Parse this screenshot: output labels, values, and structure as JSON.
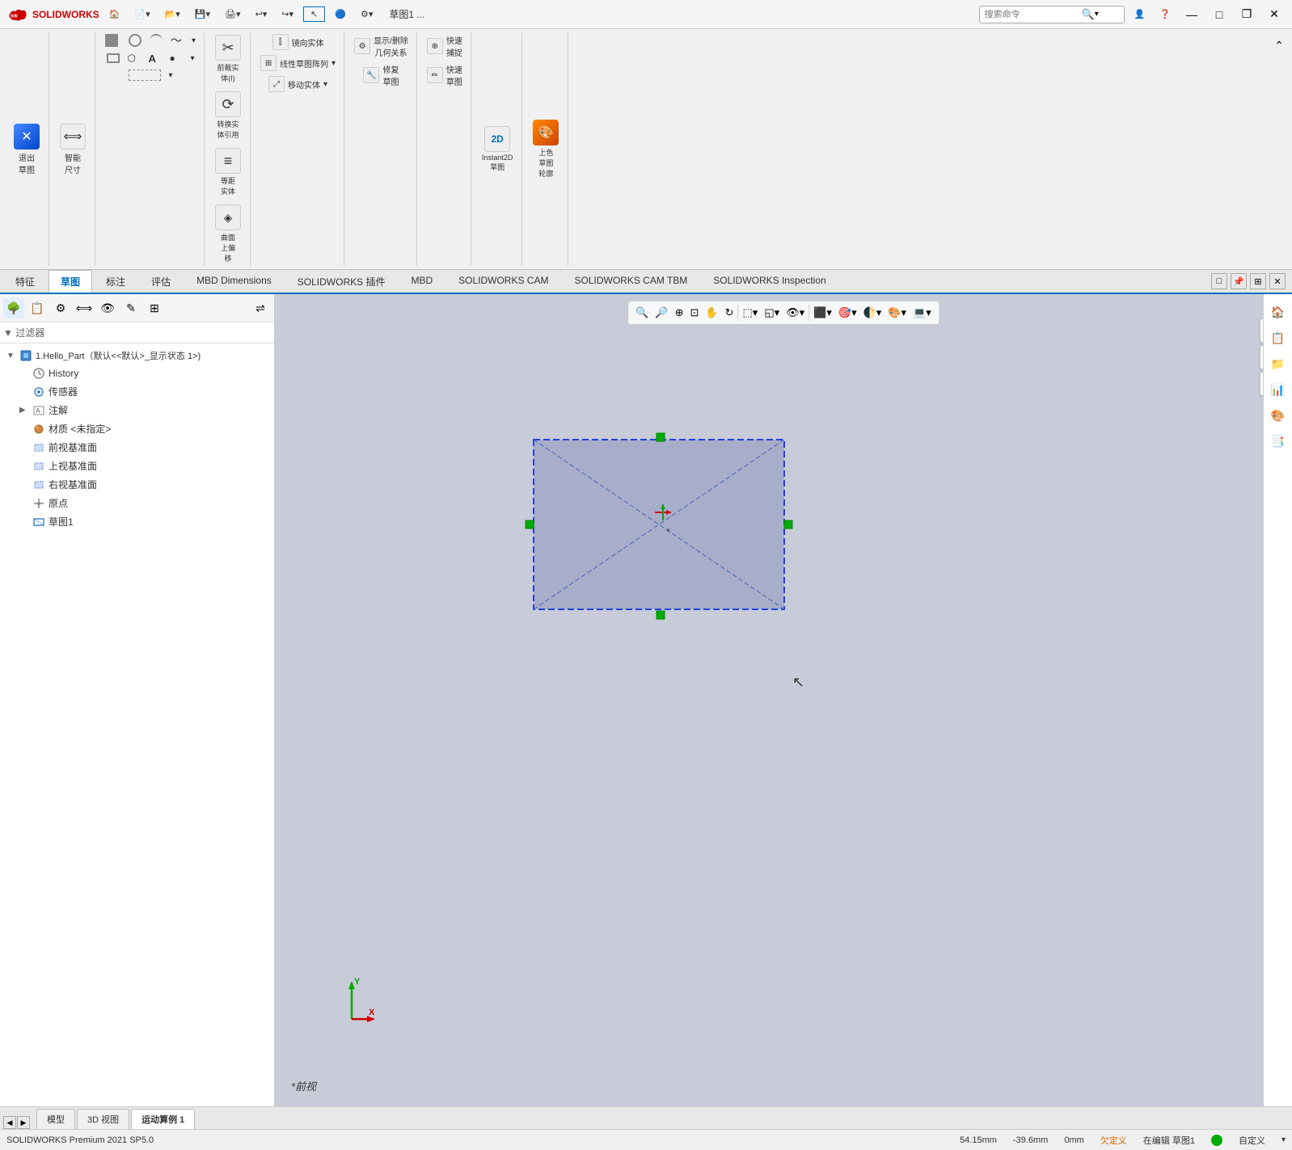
{
  "app": {
    "name": "SOLIDWORKS",
    "logo_text": "SOLIDWORKS",
    "title": "草图1 ...",
    "version": "SOLIDWORKS Premium 2021 SP5.0"
  },
  "titlebar": {
    "search_placeholder": "搜索命令",
    "minimize": "—",
    "maximize": "□",
    "restore": "❐",
    "close": "✕"
  },
  "ribbon": {
    "quick_access": [
      "←",
      "→"
    ],
    "buttons": [
      {
        "label": "退出\n草图",
        "icon": "⊠"
      },
      {
        "label": "智能\n尺寸",
        "icon": "⟷"
      },
      {
        "label": "前裁实\n体(I)",
        "icon": "✂"
      },
      {
        "label": "转换实\n体引用",
        "icon": "⟳"
      },
      {
        "label": "等距\n实体",
        "icon": "≡"
      },
      {
        "label": "曲面\n上偏\n移",
        "icon": "◈"
      },
      {
        "label": "镜向实体",
        "icon": "⫿"
      },
      {
        "label": "线性草图阵列",
        "icon": "⊞"
      },
      {
        "label": "显示/删除\n几何关系",
        "icon": "⚙"
      },
      {
        "label": "修复\n草图",
        "icon": "🔧"
      },
      {
        "label": "快速\n捕捉",
        "icon": "⊕"
      },
      {
        "label": "快速\n草图",
        "icon": "✏"
      },
      {
        "label": "Instant2D\n草图",
        "icon": "2D"
      },
      {
        "label": "上色\n草图\n轮廓",
        "icon": "🎨"
      }
    ]
  },
  "tabs": [
    {
      "label": "特征",
      "active": false
    },
    {
      "label": "草图",
      "active": true
    },
    {
      "label": "标注",
      "active": false
    },
    {
      "label": "评估",
      "active": false
    },
    {
      "label": "MBD Dimensions",
      "active": false
    },
    {
      "label": "SOLIDWORKS 插件",
      "active": false
    },
    {
      "label": "MBD",
      "active": false
    },
    {
      "label": "SOLIDWORKS CAM",
      "active": false
    },
    {
      "label": "SOLIDWORKS CAM TBM",
      "active": false
    },
    {
      "label": "SOLIDWORKS Inspection",
      "active": false
    }
  ],
  "panel": {
    "toolbar_icons": [
      "⊕",
      "≡",
      "⊙",
      "◎",
      "⬚",
      "✎",
      "⊞",
      "⇌"
    ],
    "filter_icon": "▼",
    "tree_root": "1.Hello_Part（默认<<默认>_显示状态 1>)",
    "tree_items": [
      {
        "label": "History",
        "icon": "🕐",
        "indent": 1,
        "expandable": false
      },
      {
        "label": "传感器",
        "icon": "👁",
        "indent": 1,
        "expandable": false
      },
      {
        "label": "注解",
        "icon": "A",
        "indent": 1,
        "expandable": true
      },
      {
        "label": "材质 <未指定>",
        "icon": "⚙",
        "indent": 1,
        "expandable": false
      },
      {
        "label": "前视基准面",
        "icon": "◱",
        "indent": 1,
        "expandable": false
      },
      {
        "label": "上视基准面",
        "icon": "◱",
        "indent": 1,
        "expandable": false
      },
      {
        "label": "右视基准面",
        "icon": "◱",
        "indent": 1,
        "expandable": false
      },
      {
        "label": "原点",
        "icon": "✛",
        "indent": 1,
        "expandable": false
      },
      {
        "label": "草图1",
        "icon": "✏",
        "indent": 1,
        "expandable": false
      }
    ]
  },
  "viewport": {
    "view_label": "*前视",
    "toolbar_icons": [
      "🔍",
      "🔎",
      "⊕",
      "⊡",
      "⬚",
      "◱",
      "⬛",
      "●",
      "◑",
      "🎨",
      "💻"
    ]
  },
  "status_bar": {
    "version": "SOLIDWORKS Premium 2021 SP5.0",
    "x_coord": "54.15mm",
    "y_coord": "-39.6mm",
    "z_coord": "0mm",
    "status": "欠定义",
    "editing": "在编辑 草图1",
    "customize": "自定义"
  },
  "bottom_tabs": [
    {
      "label": "模型",
      "active": false
    },
    {
      "label": "3D 视图",
      "active": false
    },
    {
      "label": "运动算例 1",
      "active": true
    }
  ],
  "colors": {
    "accent_blue": "#0070c0",
    "sketch_fill": "rgba(120,120,180,0.35)",
    "sketch_border": "#2244dd",
    "sketch_handle": "#00aa00",
    "axis_x": "#cc0000",
    "axis_y": "#00aa00",
    "bg_viewport": "#ccd0e0"
  },
  "right_panel_icons": [
    "🏠",
    "📋",
    "📁",
    "📊",
    "🎨",
    "📑"
  ]
}
